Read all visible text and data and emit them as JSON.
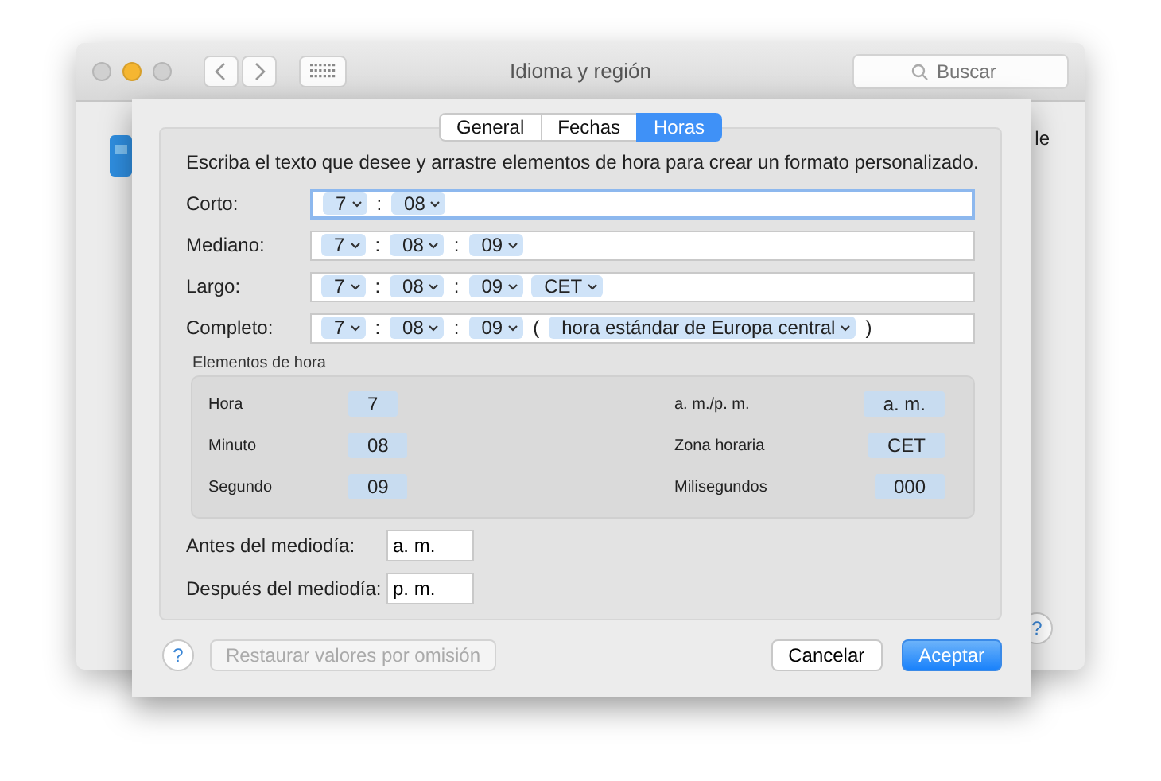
{
  "window": {
    "title": "Idioma y región",
    "search": {
      "placeholder": "Buscar"
    },
    "behind_text": "le"
  },
  "tabs": [
    {
      "label": "General",
      "selected": false
    },
    {
      "label": "Fechas",
      "selected": false
    },
    {
      "label": "Horas",
      "selected": true
    }
  ],
  "instructions": "Escriba el texto que desee y arrastre elementos de hora para crear un formato personalizado.",
  "formats": [
    {
      "label": "Corto:",
      "focused": true,
      "parts": [
        {
          "kind": "token",
          "text": "7"
        },
        {
          "kind": "sep",
          "text": ":"
        },
        {
          "kind": "token",
          "text": "08"
        }
      ]
    },
    {
      "label": "Mediano:",
      "focused": false,
      "parts": [
        {
          "kind": "token",
          "text": "7"
        },
        {
          "kind": "sep",
          "text": ":"
        },
        {
          "kind": "token",
          "text": "08"
        },
        {
          "kind": "sep",
          "text": ":"
        },
        {
          "kind": "token",
          "text": "09"
        }
      ]
    },
    {
      "label": "Largo:",
      "focused": false,
      "parts": [
        {
          "kind": "token",
          "text": "7"
        },
        {
          "kind": "sep",
          "text": ":"
        },
        {
          "kind": "token",
          "text": "08"
        },
        {
          "kind": "sep",
          "text": ":"
        },
        {
          "kind": "token",
          "text": "09"
        },
        {
          "kind": "token",
          "text": "CET"
        }
      ]
    },
    {
      "label": "Completo:",
      "focused": false,
      "parts": [
        {
          "kind": "token",
          "text": "7"
        },
        {
          "kind": "sep",
          "text": ":"
        },
        {
          "kind": "token",
          "text": "08"
        },
        {
          "kind": "sep",
          "text": ":"
        },
        {
          "kind": "token",
          "text": "09"
        },
        {
          "kind": "sep",
          "text": "("
        },
        {
          "kind": "token",
          "text": "hora estándar de Europa central"
        },
        {
          "kind": "sep",
          "text": ")"
        }
      ]
    }
  ],
  "elements": {
    "title": "Elementos de hora",
    "items": [
      {
        "label": "Hora",
        "value": "7"
      },
      {
        "label": "a. m./p. m.",
        "value": "a. m."
      },
      {
        "label": "Minuto",
        "value": "08"
      },
      {
        "label": "Zona horaria",
        "value": "CET"
      },
      {
        "label": "Segundo",
        "value": "09"
      },
      {
        "label": "Milisegundos",
        "value": "000"
      }
    ]
  },
  "ampm": [
    {
      "label": "Antes del mediodía:",
      "value": "a. m."
    },
    {
      "label": "Después del mediodía:",
      "value": "p. m."
    }
  ],
  "buttons": {
    "help": "?",
    "restore": {
      "label": "Restaurar valores por omisión",
      "disabled": true
    },
    "cancel": "Cancelar",
    "accept": "Aceptar",
    "behind_help": "?"
  }
}
